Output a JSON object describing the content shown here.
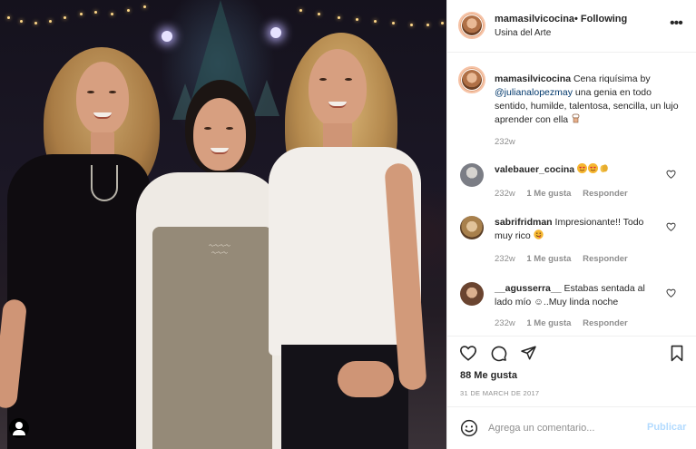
{
  "colors": {
    "text": "#262626",
    "muted": "#8e8e8e",
    "link": "#00376b",
    "publish_disabled": "#b3dbff",
    "divider": "#efefef"
  },
  "photo": {
    "description_icon": "user-silhouette-icon"
  },
  "header": {
    "username": "mamasilvicocina",
    "separator": "•",
    "follow_state": "Following",
    "location": "Usina del Arte",
    "more_icon": "more-horizontal-icon"
  },
  "caption": {
    "username": "mamasilvicocina",
    "text_before": "Cena riquísima by",
    "mention": "@julianalopezmay",
    "text_after": "una genia en todo sentido, humilde, talentosa, sencilla, un lujo aprender con ella",
    "emoji_icon": "chef-hat-emoji",
    "age": "232w"
  },
  "comments": [
    {
      "username": "valebauer_cocina",
      "text": "",
      "emojis": [
        "heart-eyes-emoji",
        "heart-eyes-emoji",
        "clapping-hands-emoji"
      ],
      "age": "232w",
      "likes": "1 Me gusta",
      "reply": "Responder"
    },
    {
      "username": "sabrifridman",
      "text": "Impresionante!! Todo muy rico",
      "emojis": [
        "yum-face-emoji"
      ],
      "age": "232w",
      "likes": "1 Me gusta",
      "reply": "Responder"
    },
    {
      "username": "__agusserra__",
      "text": "Estabas sentada al lado mío ☺..Muy linda noche",
      "emojis": [],
      "age": "232w",
      "likes": "1 Me gusta",
      "reply": "Responder"
    }
  ],
  "actions": {
    "like_icon": "heart-icon",
    "comment_icon": "comment-bubble-icon",
    "share_icon": "paper-plane-icon",
    "save_icon": "bookmark-icon"
  },
  "likes_count": "88 Me gusta",
  "post_date": "31 DE MARCH DE 2017",
  "composer": {
    "emoji_icon": "smiley-face-icon",
    "placeholder": "Agrega un comentario...",
    "submit_label": "Publicar"
  }
}
